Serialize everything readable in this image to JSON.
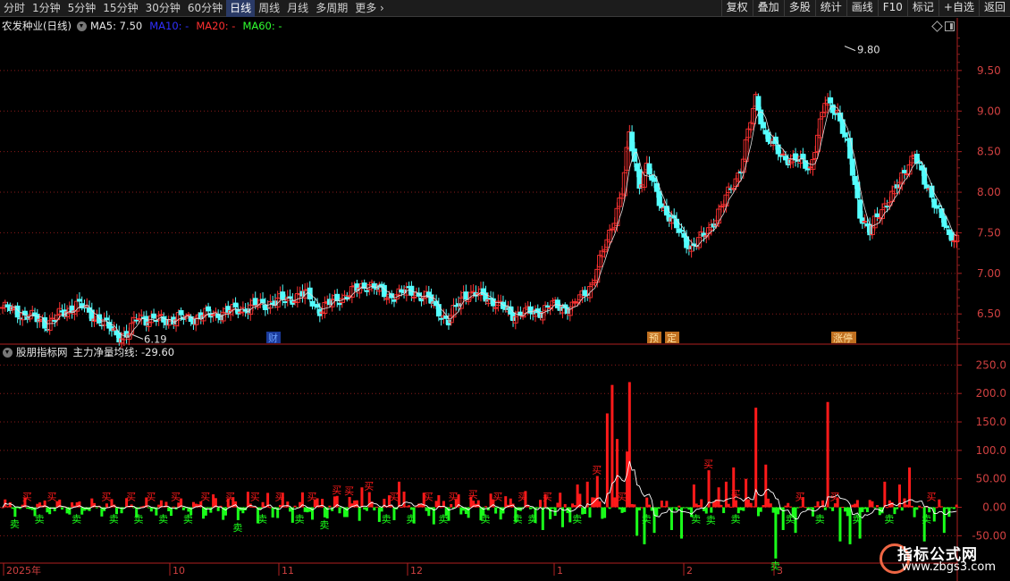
{
  "toolbar": {
    "periods": [
      "分时",
      "1分钟",
      "5分钟",
      "15分钟",
      "30分钟",
      "60分钟",
      "日线",
      "周线",
      "月线",
      "多周期",
      "更多"
    ],
    "active": "日线",
    "more_arrow": "›",
    "buttons": [
      "复权",
      "叠加",
      "多股",
      "统计",
      "画线",
      "F10",
      "标记",
      "+自选",
      "返回"
    ]
  },
  "price_panel": {
    "stock_title": "农发种业(日线)",
    "ma5": "MA5: 7.50",
    "ma10": "MA10: -",
    "ma20": "MA20: -",
    "ma60": "MA60: -",
    "high_label": "9.80",
    "low_label": "6.19",
    "event_tags": [
      "财",
      "预",
      "定",
      "涨停"
    ]
  },
  "indicator_panel": {
    "title": "股朋指标网",
    "line_label": "主力净量均线: -29.60",
    "buy_label": "买",
    "sell_label": "卖"
  },
  "colors": {
    "up": "#ff3232",
    "down": "#54ffff",
    "bar_up": "#ff1a1a",
    "bar_down": "#1aff1a",
    "grid": "#8b1a1a",
    "axis_text": "#d04040"
  },
  "chart_data": [
    {
      "type": "candlestick",
      "ylim": [
        6.15,
        9.95
      ],
      "yticks": [
        6.5,
        7.0,
        7.5,
        8.0,
        8.5,
        9.0,
        9.5
      ],
      "ma5_last": 7.5,
      "annotations": [
        {
          "text": "9.80",
          "value": 9.8
        },
        {
          "text": "6.19",
          "value": 6.19
        }
      ]
    },
    {
      "type": "bar",
      "ylim": [
        -95,
        260
      ],
      "yticks": [
        "250.0",
        "200.0",
        "150.0",
        "100.0",
        "50.00",
        "0.00",
        "-50.00"
      ],
      "line_last": -29.6
    }
  ],
  "x_axis": {
    "labels": [
      "2025年",
      "10",
      "11",
      "12",
      "1",
      "2",
      "3"
    ]
  },
  "watermark": {
    "title": "指标公式网",
    "url": "www.zbgs3.com"
  }
}
